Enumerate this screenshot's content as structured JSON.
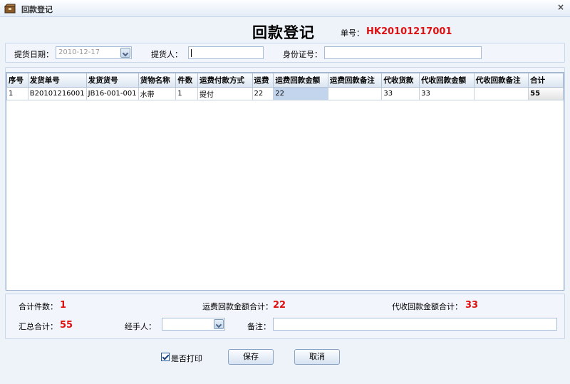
{
  "window": {
    "title": "回款登记",
    "close_glyph": "×"
  },
  "header": {
    "title": "回款登记",
    "order_label": "单号：",
    "order_no": "HK20101217001"
  },
  "form": {
    "date_label": "提货日期：",
    "date_value": "2010-12-17",
    "picker_label": "提货人：",
    "picker_value": "",
    "id_label": "身份证号：",
    "id_value": ""
  },
  "table": {
    "columns": [
      "序号",
      "发货单号",
      "发货货号",
      "货物名称",
      "件数",
      "运费付款方式",
      "运费",
      "运费回款金额",
      "运费回款备注",
      "代收货款",
      "代收回款金额",
      "代收回款备注",
      "合计"
    ],
    "rows": [
      [
        "1",
        "B20101216001",
        "JB16-001-001",
        "水带",
        "1",
        "提付",
        "22",
        "22",
        "",
        "33",
        "33",
        "",
        "55"
      ]
    ]
  },
  "summary": {
    "count_label": "合计件数：",
    "count_value": "1",
    "freight_label": "运费回款金额合计：",
    "freight_value": "22",
    "collect_label": "代收回款金额合计：",
    "collect_value": "33",
    "total_label": "汇总合计：",
    "total_value": "55",
    "handler_label": "经手人：",
    "handler_value": "",
    "remark_label": "备注：",
    "remark_value": ""
  },
  "actions": {
    "print_label": "是否打印",
    "print_checked": true,
    "save_label": "保存",
    "cancel_label": "取消"
  },
  "colors": {
    "accent_red": "#e01010",
    "selected_cell": "#c3d4ed"
  }
}
